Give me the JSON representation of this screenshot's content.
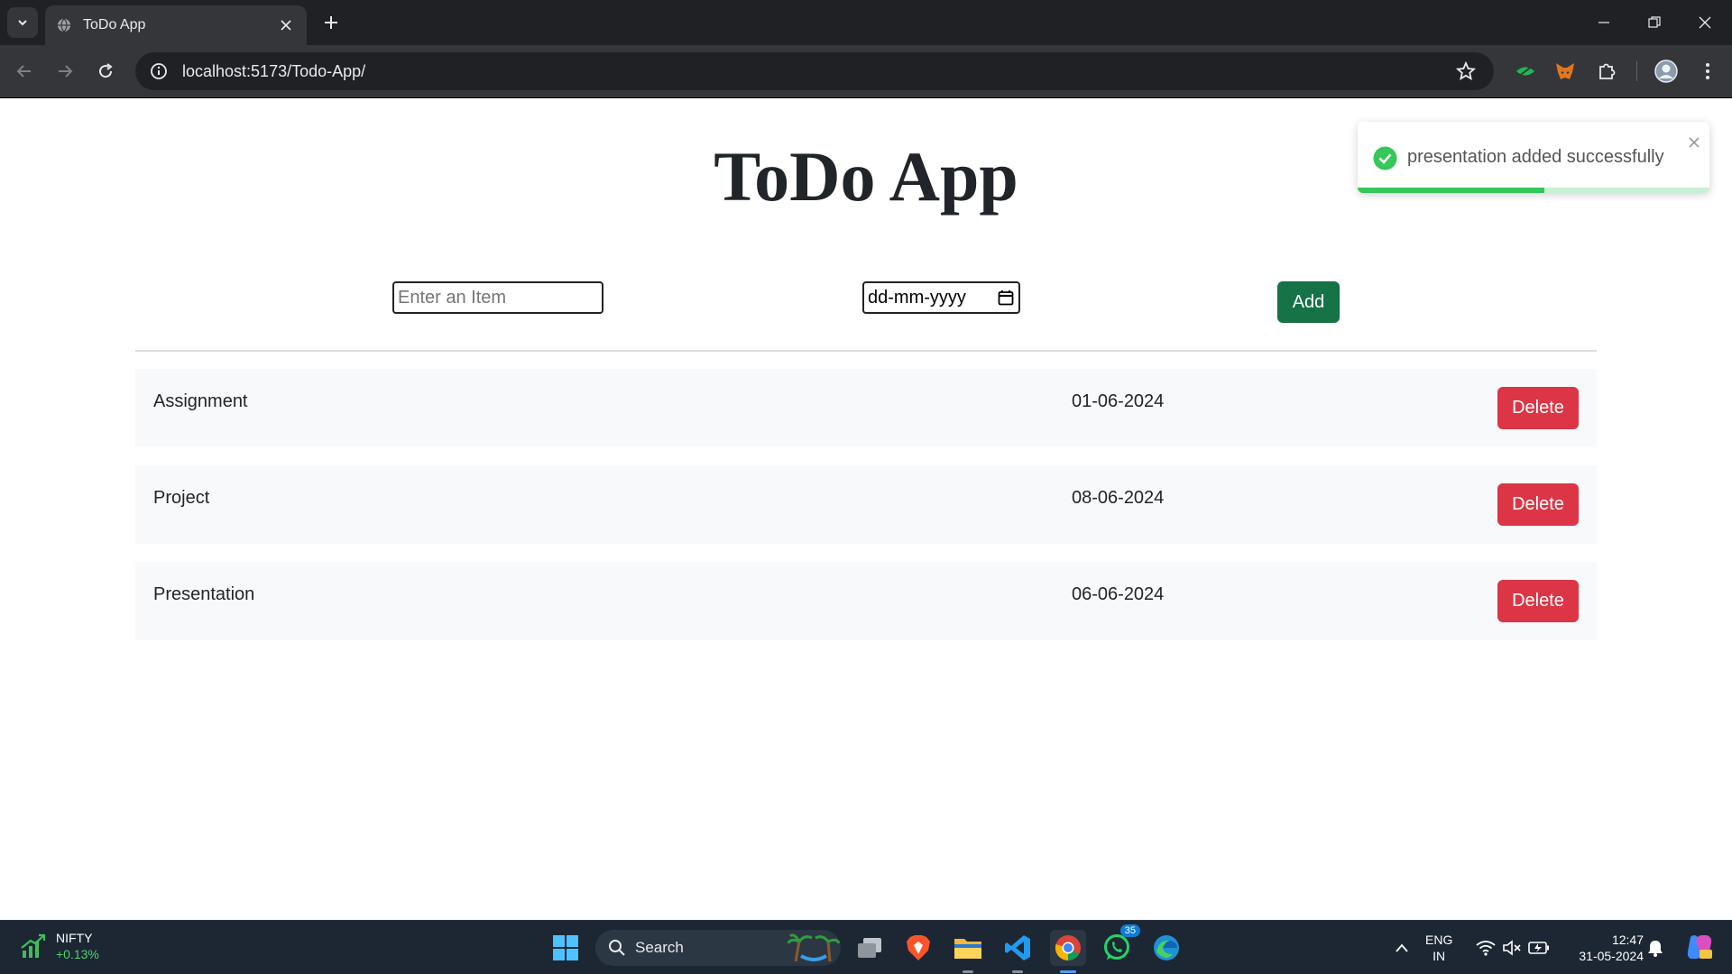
{
  "browser": {
    "tab_title": "ToDo App",
    "url": "localhost:5173/Todo-App/"
  },
  "app": {
    "title": "ToDo App",
    "item_placeholder": "Enter an Item",
    "date_placeholder": "dd-mm-yyyy",
    "add_label": "Add",
    "delete_label": "Delete",
    "todos": [
      {
        "name": "Assignment",
        "date": "01-06-2024"
      },
      {
        "name": "Project",
        "date": "08-06-2024"
      },
      {
        "name": "Presentation",
        "date": "06-06-2024"
      }
    ]
  },
  "toast": {
    "message": "presentation added successfully",
    "progress": 0.53,
    "color": "#35c759"
  },
  "taskbar": {
    "widget_name": "NIFTY",
    "widget_value": "+0.13%",
    "search_label": "Search",
    "whatsapp_badge": "35",
    "lang_line1": "ENG",
    "lang_line2": "IN",
    "time": "12:47",
    "date": "31-05-2024"
  },
  "colors": {
    "add_button": "#157347",
    "delete_button": "#dc3545",
    "row_background": "#f8f9fa"
  }
}
